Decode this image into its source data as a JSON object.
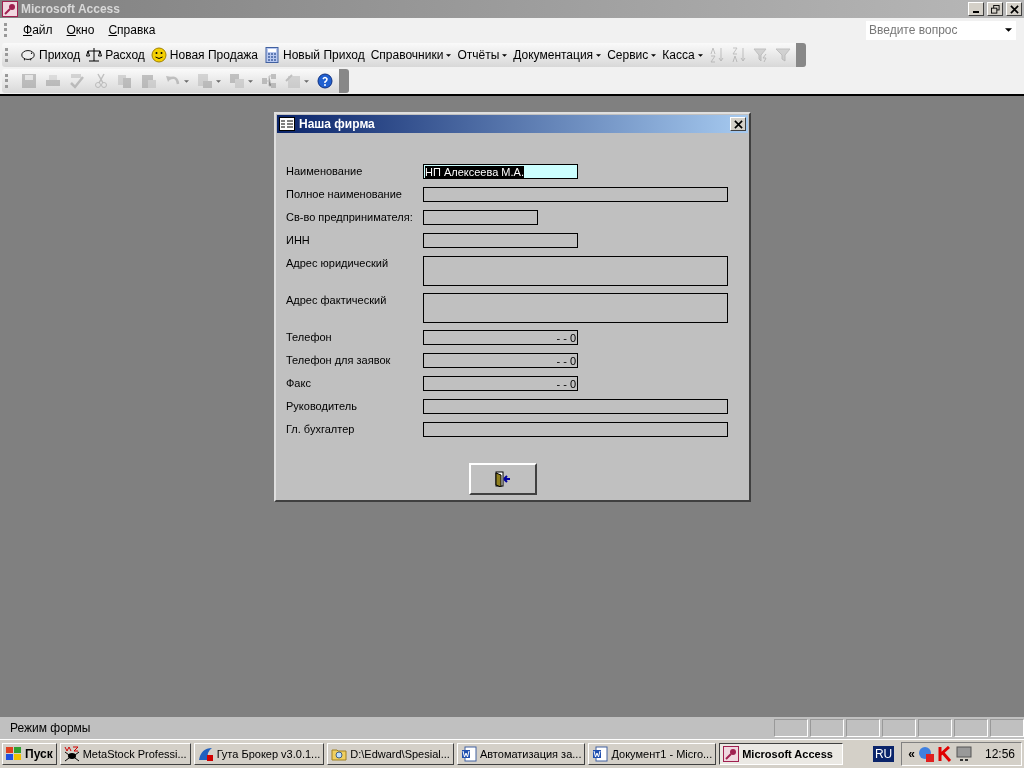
{
  "window": {
    "title": "Microsoft Access"
  },
  "menu": [
    {
      "label": "Файл"
    },
    {
      "label": "Окно"
    },
    {
      "label": "Справка"
    }
  ],
  "help_box": {
    "placeholder": "Введите вопрос"
  },
  "toolbar": [
    {
      "kind": "piggy",
      "label": "Приход",
      "dropdown": false,
      "disabled": false
    },
    {
      "kind": "scales",
      "label": "Расход",
      "dropdown": false,
      "disabled": false
    },
    {
      "kind": "smiley",
      "label": "Новая Продажа",
      "dropdown": false,
      "disabled": false
    },
    {
      "kind": "calculator",
      "label": "Новый Приход",
      "dropdown": false,
      "disabled": false
    },
    {
      "kind": "menu",
      "label": "Справочники",
      "dropdown": true,
      "disabled": false
    },
    {
      "kind": "menu",
      "label": "Отчёты",
      "dropdown": true,
      "disabled": false
    },
    {
      "kind": "menu",
      "label": "Документация",
      "dropdown": true,
      "disabled": false
    },
    {
      "kind": "menu",
      "label": "Сервис",
      "dropdown": true,
      "disabled": false
    },
    {
      "kind": "menu",
      "label": "Касса",
      "dropdown": true,
      "disabled": false
    },
    {
      "kind": "sort-asc",
      "dropdown": false,
      "disabled": true
    },
    {
      "kind": "sort-desc",
      "dropdown": false,
      "disabled": true
    },
    {
      "kind": "filter-selection",
      "dropdown": false,
      "disabled": true
    },
    {
      "kind": "filter",
      "dropdown": false,
      "disabled": true
    }
  ],
  "toolbar2": [
    {
      "kind": "save",
      "dropdown": false,
      "disabled": true
    },
    {
      "kind": "print",
      "dropdown": false,
      "disabled": true
    },
    {
      "kind": "spelling",
      "dropdown": false,
      "disabled": true
    },
    {
      "kind": "cut",
      "dropdown": false,
      "disabled": true
    },
    {
      "kind": "copy",
      "dropdown": false,
      "disabled": true
    },
    {
      "kind": "paste",
      "dropdown": false,
      "disabled": true
    },
    {
      "kind": "undo",
      "dropdown": true,
      "disabled": true
    },
    {
      "kind": "office-links",
      "dropdown": true,
      "disabled": true
    },
    {
      "kind": "new-object",
      "dropdown": true,
      "disabled": true
    },
    {
      "kind": "relationships",
      "dropdown": false,
      "disabled": true
    },
    {
      "kind": "properties",
      "dropdown": true,
      "disabled": true
    },
    {
      "kind": "help",
      "dropdown": false,
      "disabled": false
    }
  ],
  "form": {
    "title": "Наша фирма",
    "fields": [
      {
        "kind": "medium",
        "label": "Наименование",
        "value": "НП Алексеева М.А.",
        "focused": true
      },
      {
        "kind": "long",
        "label": "Полное наименование",
        "focused": false
      },
      {
        "kind": "small",
        "label": "Св-во предпринимателя:",
        "focused": false
      },
      {
        "kind": "medium",
        "label": "ИНН",
        "focused": false
      },
      {
        "kind": "address",
        "label": "Адрес юридический",
        "focused": false
      },
      {
        "kind": "address",
        "label": "Адрес фактический",
        "focused": false
      },
      {
        "kind": "phone",
        "label": "Телефон",
        "value": "- - 0",
        "focused": false
      },
      {
        "kind": "phone",
        "label": "Телефон для заявок",
        "value": "- - 0",
        "focused": false
      },
      {
        "kind": "phone",
        "label": "Факс",
        "value": "- - 0",
        "focused": false
      },
      {
        "kind": "long",
        "label": "Руководитель",
        "focused": false
      },
      {
        "kind": "long",
        "label": "Гл. бухгалтер",
        "focused": false
      }
    ]
  },
  "status_bar": {
    "text": "Режим формы"
  },
  "taskbar": {
    "start": "Пуск",
    "tasks": [
      {
        "kind": "metastock",
        "label": "MetaStock Professi...",
        "selected": false
      },
      {
        "kind": "broker",
        "label": "Гута Брокер v3.0.1...",
        "selected": false
      },
      {
        "kind": "folder",
        "label": "D:\\Edward\\Spesial...",
        "selected": false
      },
      {
        "kind": "word",
        "label": "Автоматизация за...",
        "selected": false
      },
      {
        "kind": "word",
        "label": "Документ1 - Micro...",
        "selected": false
      },
      {
        "kind": "access",
        "label": "Microsoft Access",
        "selected": true
      }
    ],
    "language": "RU",
    "tray_chevron": "«",
    "clock": "12:56"
  }
}
